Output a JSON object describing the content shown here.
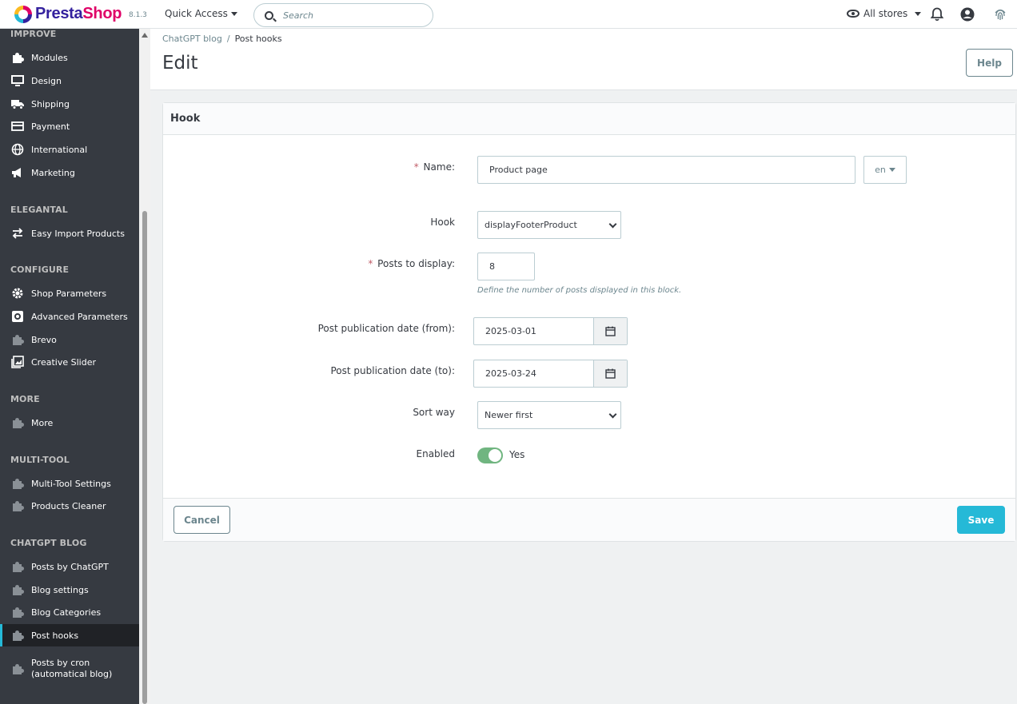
{
  "header": {
    "logo_part1": "Presta",
    "logo_part2": "Shop",
    "version": "8.1.3",
    "quick_access": "Quick Access",
    "search_placeholder": "Search",
    "stores": "All stores",
    "icons": [
      "bell-icon",
      "account-icon",
      "fingerprint-icon"
    ]
  },
  "sidebar": {
    "sections": [
      {
        "title": "IMPROVE",
        "items": [
          {
            "label": "Modules",
            "icon": "puzzle-icon"
          },
          {
            "label": "Design",
            "icon": "monitor-icon"
          },
          {
            "label": "Shipping",
            "icon": "truck-icon"
          },
          {
            "label": "Payment",
            "icon": "credit-card-icon"
          },
          {
            "label": "International",
            "icon": "globe-icon"
          },
          {
            "label": "Marketing",
            "icon": "megaphone-icon"
          }
        ]
      },
      {
        "title": "ELEGANTAL",
        "items": [
          {
            "label": "Easy Import Products",
            "icon": "swap-icon"
          }
        ]
      },
      {
        "title": "CONFIGURE",
        "items": [
          {
            "label": "Shop Parameters",
            "icon": "gear-icon"
          },
          {
            "label": "Advanced Parameters",
            "icon": "settings-box-icon"
          },
          {
            "label": "Brevo",
            "icon": "puzzle-icon"
          },
          {
            "label": "Creative Slider",
            "icon": "image-icon"
          }
        ]
      },
      {
        "title": "MORE",
        "items": [
          {
            "label": "More",
            "icon": "puzzle-icon"
          }
        ]
      },
      {
        "title": "MULTI-TOOL",
        "items": [
          {
            "label": "Multi-Tool Settings",
            "icon": "puzzle-icon"
          },
          {
            "label": "Products Cleaner",
            "icon": "puzzle-icon"
          }
        ]
      },
      {
        "title": "CHATGPT BLOG",
        "items": [
          {
            "label": "Posts by ChatGPT",
            "icon": "puzzle-icon"
          },
          {
            "label": "Blog settings",
            "icon": "puzzle-icon"
          },
          {
            "label": "Blog Categories",
            "icon": "puzzle-icon"
          },
          {
            "label": "Post hooks",
            "icon": "puzzle-icon",
            "active": true
          },
          {
            "label_line1": "Posts by cron",
            "label_line2": "(automatical blog)",
            "icon": "puzzle-icon"
          }
        ]
      }
    ]
  },
  "page": {
    "breadcrumb": [
      "ChatGPT blog",
      "Post hooks"
    ],
    "title": "Edit",
    "help": "Help"
  },
  "form": {
    "panel_title": "Hook",
    "name_label": "Name:",
    "name_value": "Product page",
    "lang": "en",
    "hook_label": "Hook",
    "hook_value": "displayFooterProduct",
    "posts_label": "Posts to display:",
    "posts_value": "8",
    "posts_help": "Define the number of posts displayed in this block.",
    "date_from_label": "Post publication date (from):",
    "date_from_value": "2025-03-01",
    "date_to_label": "Post publication date (to):",
    "date_to_value": "2025-03-24",
    "sort_label": "Sort way",
    "sort_value": "Newer first",
    "enabled_label": "Enabled",
    "enabled_value": "Yes",
    "cancel": "Cancel",
    "save": "Save"
  },
  "colors": {
    "accent": "#25b9d7",
    "sidebar_bg": "#363a41",
    "toggle_on": "#70b580",
    "required": "#c05c67"
  }
}
